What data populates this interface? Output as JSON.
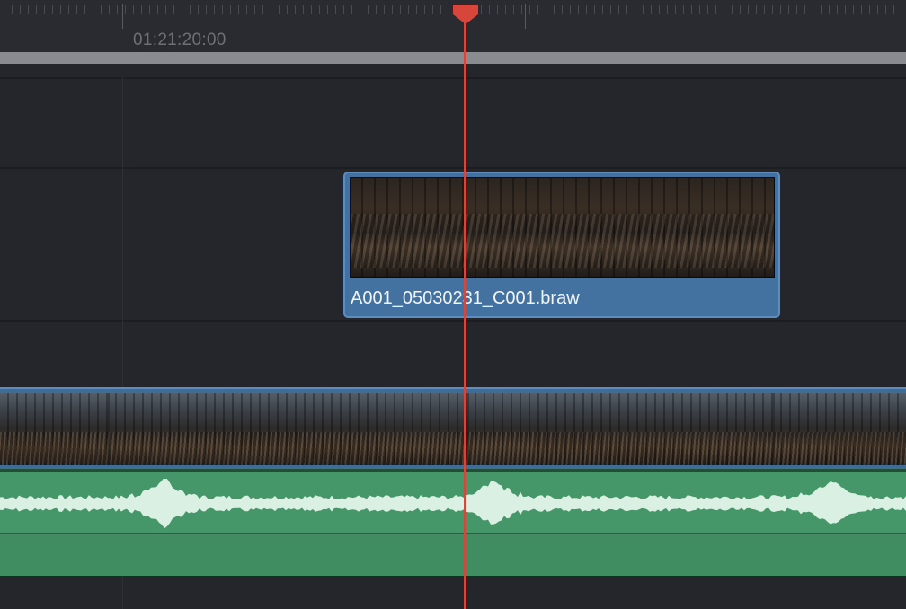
{
  "ruler": {
    "timecode": "01:21:20:00"
  },
  "tracks": {
    "v2_clip": {
      "name": "A001_05030231_C001.braw"
    }
  },
  "colors": {
    "playhead": "#d8453a",
    "video_clip": "#4372a0",
    "audio_clip": "#459668",
    "background": "#232429"
  },
  "icons": {
    "playhead": "playhead-marker-icon"
  }
}
